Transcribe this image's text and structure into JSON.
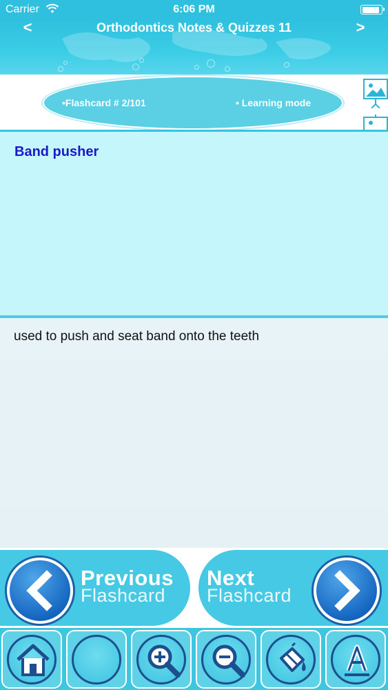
{
  "status_bar": {
    "carrier": "Carrier",
    "time": "6:06 PM",
    "battery_level": 0.95,
    "wifi_icon": "wifi-icon",
    "battery_icon": "battery-icon"
  },
  "nav": {
    "title": "Orthodontics Notes & Quizzes 11",
    "back_label": "<",
    "forward_label": ">"
  },
  "info": {
    "flashcard_number": "•Flashcard #  2/101",
    "mode": "• Learning mode",
    "slide_icon": "presentation-image-icon"
  },
  "card": {
    "question": "Band pusher",
    "answer": "used to push and seat band onto the teeth"
  },
  "buttons": {
    "previous_line1": "Previous",
    "previous_line2": "Flashcard",
    "next_line1": "Next",
    "next_line2": "Flashcard"
  },
  "toolbar": {
    "items": [
      "home-icon",
      "blank-circle-icon",
      "zoom-in-icon",
      "zoom-out-icon",
      "paint-bucket-icon",
      "font-icon"
    ]
  },
  "colors": {
    "header": "#2ec0de",
    "question_bg": "#c4f6fc",
    "answer_bg": "#e6f4f8",
    "question_text": "#1919c8",
    "button_blue": "#1667c2",
    "button_cyan": "#45c9e4"
  }
}
